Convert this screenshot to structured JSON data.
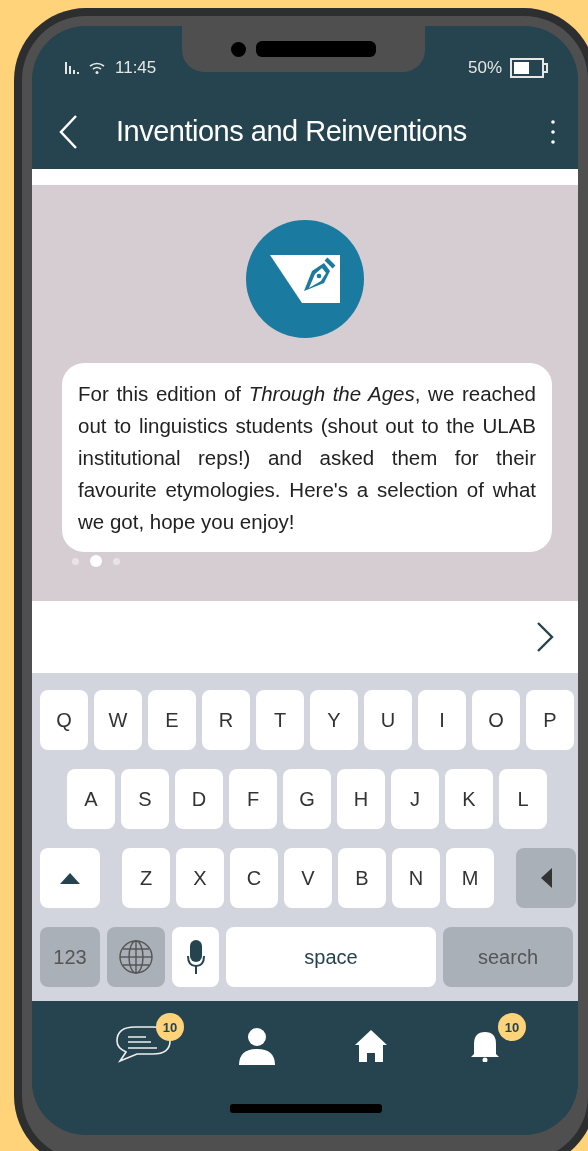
{
  "status_bar": {
    "time": "11:45",
    "battery": "50%"
  },
  "header": {
    "title": "Inventions and Reinventions"
  },
  "message": {
    "text": "For this edition of *Through the Ages*, we reached out to linguistics students (shout out to the ULAB institutional reps!) and asked them for their favourite etymologies. Here's a selection of what we got, hope you enjoy!"
  },
  "carousel_dots": [
    {
      "selected": false
    },
    {
      "selected": true
    },
    {
      "selected": false
    }
  ],
  "keyboard": {
    "row_1": [
      {
        "kind": "letter",
        "label": "Q"
      },
      {
        "kind": "letter",
        "label": "W"
      },
      {
        "kind": "letter",
        "label": "E"
      },
      {
        "kind": "letter",
        "label": "R"
      },
      {
        "kind": "letter",
        "label": "T"
      },
      {
        "kind": "letter",
        "label": "Y"
      },
      {
        "kind": "letter",
        "label": "U"
      },
      {
        "kind": "letter",
        "label": "I"
      },
      {
        "kind": "letter",
        "label": "O"
      },
      {
        "kind": "letter",
        "label": "P"
      }
    ],
    "row_2": [
      {
        "kind": "letter",
        "label": "A"
      },
      {
        "kind": "letter",
        "label": "S"
      },
      {
        "kind": "letter",
        "label": "D"
      },
      {
        "kind": "letter",
        "label": "F"
      },
      {
        "kind": "letter",
        "label": "G"
      },
      {
        "kind": "letter",
        "label": "H"
      },
      {
        "kind": "letter",
        "label": "J"
      },
      {
        "kind": "letter",
        "label": "K"
      },
      {
        "kind": "letter",
        "label": "L"
      }
    ],
    "row_3": [
      {
        "kind": "shift"
      },
      {
        "kind": "letter",
        "label": "Z"
      },
      {
        "kind": "letter",
        "label": "X"
      },
      {
        "kind": "letter",
        "label": "C"
      },
      {
        "kind": "letter",
        "label": "V"
      },
      {
        "kind": "letter",
        "label": "B"
      },
      {
        "kind": "letter",
        "label": "N"
      },
      {
        "kind": "letter",
        "label": "M"
      },
      {
        "kind": "backspace"
      }
    ],
    "row_4": [
      {
        "kind": "mode",
        "label": "123"
      },
      {
        "kind": "globe"
      },
      {
        "kind": "mic"
      },
      {
        "kind": "space",
        "label": "space"
      },
      {
        "kind": "search",
        "label": "search"
      }
    ]
  },
  "nav": [
    {
      "kind": "chat",
      "badge": "10"
    },
    {
      "kind": "profile"
    },
    {
      "kind": "home"
    },
    {
      "kind": "bell",
      "badge": "10"
    }
  ]
}
